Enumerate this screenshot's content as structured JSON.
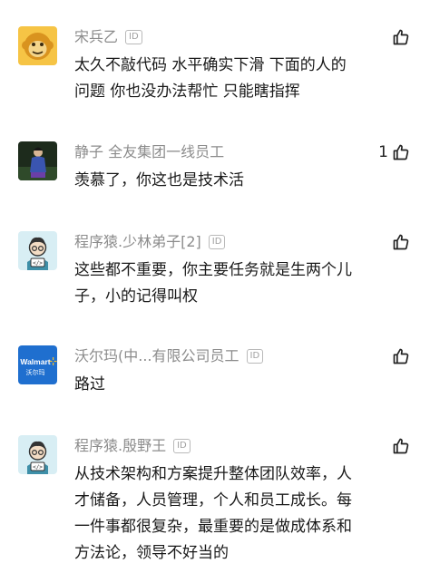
{
  "comments": [
    {
      "username": "宋兵乙",
      "id_label": "ID",
      "text": "太久不敲代码 水平确实下滑 下面的人的\n问题 你也没办法帮忙 只能瞎指挥",
      "likes": "",
      "avatar": "orange-monkey-avatar"
    },
    {
      "username": "静子  全友集团一线员工",
      "id_label": "",
      "text": "羡慕了，你这也是技术活",
      "likes": "1",
      "avatar": "photo-avatar"
    },
    {
      "username": "程序猿.少林弟子[2]",
      "id_label": "ID",
      "text": "这些都不重要，你主要任务就是生两个儿\n子，小的记得叫权",
      "likes": "",
      "avatar": "programmer-avatar"
    },
    {
      "username": "沃尔玛(中...有限公司员工",
      "id_label": "ID",
      "text": "路过",
      "likes": "",
      "avatar": "walmart-logo-avatar",
      "logo_text": "Walmart",
      "logo_sub": "沃尔玛"
    },
    {
      "username": "程序猿.殷野王",
      "id_label": "ID",
      "text": "从技术架构和方案提升整体团队效率，人\n才储备，人员管理，个人和员工成长。每\n一件事都很复杂，最重要的是做成体系和\n方法论，领导不好当的",
      "likes": "",
      "avatar": "programmer-avatar"
    }
  ],
  "colors": {
    "username": "#8c8c8c",
    "text": "#1a1a1a",
    "monkey": "#f4b93b",
    "walmart": "#1f6fcf",
    "programmer_bg": "#d8eef4"
  }
}
